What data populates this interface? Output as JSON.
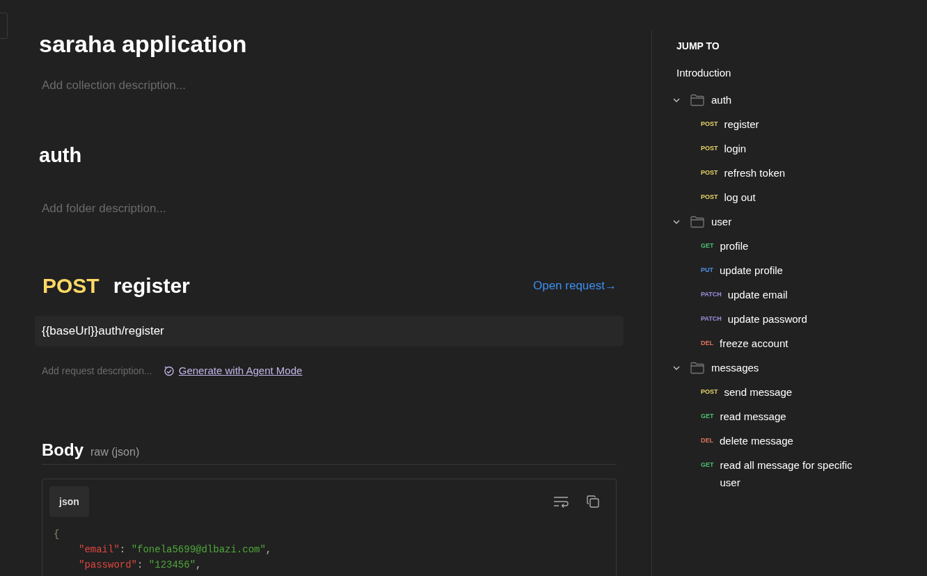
{
  "collection": {
    "title": "saraha application",
    "description_placeholder": "Add collection description..."
  },
  "folder": {
    "title": "auth",
    "description_placeholder": "Add folder description..."
  },
  "request": {
    "method": "POST",
    "name": "register",
    "open_link": "Open request→",
    "url": "{{baseUrl}}auth/register",
    "description_placeholder": "Add request description...",
    "agent_link": "Generate with Agent Mode"
  },
  "body": {
    "title": "Body",
    "mode": "raw (json)",
    "language_tab": "json",
    "code": [
      {
        "kind": "brace",
        "text": "{"
      },
      {
        "kind": "pair",
        "key": "\"email\"",
        "sep": ": ",
        "value": "\"fonela5699@dlbazi.com\"",
        "end": ","
      },
      {
        "kind": "pair",
        "key": "\"password\"",
        "sep": ": ",
        "value": "\"123456\"",
        "end": ","
      }
    ]
  },
  "jump_to": {
    "title": "JUMP TO",
    "intro": "Introduction",
    "folders": [
      {
        "name": "auth",
        "expanded": true,
        "children": [
          {
            "method": "POST",
            "color": "#e8d66a",
            "name": "register"
          },
          {
            "method": "POST",
            "color": "#e8d66a",
            "name": "login"
          },
          {
            "method": "POST",
            "color": "#e8d66a",
            "name": "refresh token"
          },
          {
            "method": "POST",
            "color": "#e8d66a",
            "name": "log out"
          }
        ]
      },
      {
        "name": "user",
        "expanded": true,
        "children": [
          {
            "method": "GET",
            "color": "#4fbf73",
            "name": "profile"
          },
          {
            "method": "PUT",
            "color": "#4f8fe8",
            "name": "update profile"
          },
          {
            "method": "PATCH",
            "color": "#9b90e0",
            "name": "update email"
          },
          {
            "method": "PATCH",
            "color": "#9b90e0",
            "name": "update password"
          },
          {
            "method": "DEL",
            "color": "#e5735e",
            "name": "freeze account"
          }
        ]
      },
      {
        "name": "messages",
        "expanded": true,
        "children": [
          {
            "method": "POST",
            "color": "#e8d66a",
            "name": "send message"
          },
          {
            "method": "GET",
            "color": "#4fbf73",
            "name": "read message"
          },
          {
            "method": "DEL",
            "color": "#e5735e",
            "name": "delete message"
          },
          {
            "method": "GET",
            "color": "#4fbf73",
            "name": "read all message for specific user"
          }
        ]
      }
    ]
  }
}
